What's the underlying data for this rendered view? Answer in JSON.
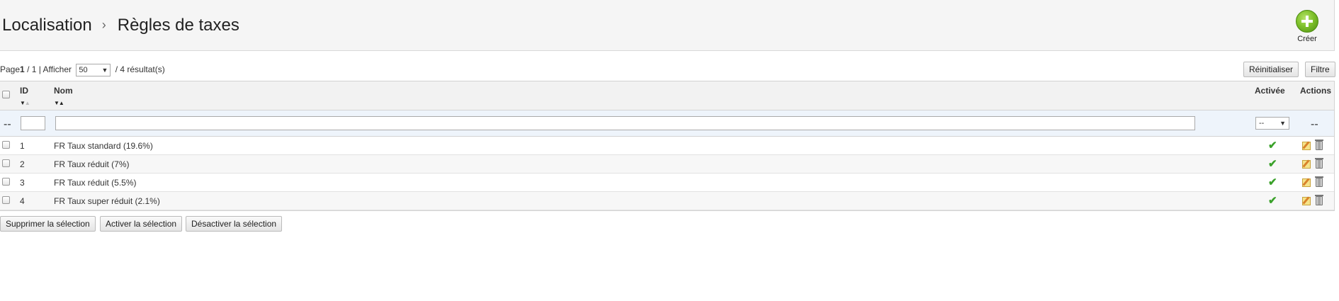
{
  "breadcrumb": {
    "parent": "Localisation",
    "separator": "›",
    "current": "Règles de taxes"
  },
  "toolbar": {
    "create_label": "Créer",
    "create_icon": "plus-circle-icon",
    "accent": "#7fc12b"
  },
  "pagination": {
    "page_prefix": "Page",
    "page_current": "1",
    "page_total": "/ 1",
    "show_label": "| Afficher",
    "per_page": "50",
    "results": "/ 4 résultat(s)"
  },
  "filter_buttons": {
    "reset": "Réinitialiser",
    "filter": "Filtre"
  },
  "table": {
    "columns": {
      "id": "ID",
      "name": "Nom",
      "active": "Activée",
      "actions": "Actions"
    },
    "filter_row": {
      "left_dash": "--",
      "active_select": "--",
      "actions_dash": "--"
    },
    "rows": [
      {
        "id": "1",
        "name": "FR Taux standard (19.6%)",
        "active": true
      },
      {
        "id": "2",
        "name": "FR Taux réduit (7%)",
        "active": true
      },
      {
        "id": "3",
        "name": "FR Taux réduit (5.5%)",
        "active": true
      },
      {
        "id": "4",
        "name": "FR Taux super réduit (2.1%)",
        "active": true
      }
    ]
  },
  "bulk_actions": {
    "delete": "Supprimer la sélection",
    "enable": "Activer la sélection",
    "disable": "Désactiver la sélection"
  },
  "icons": {
    "active": "check-icon",
    "edit": "edit-pencil-icon",
    "delete": "trash-icon"
  }
}
